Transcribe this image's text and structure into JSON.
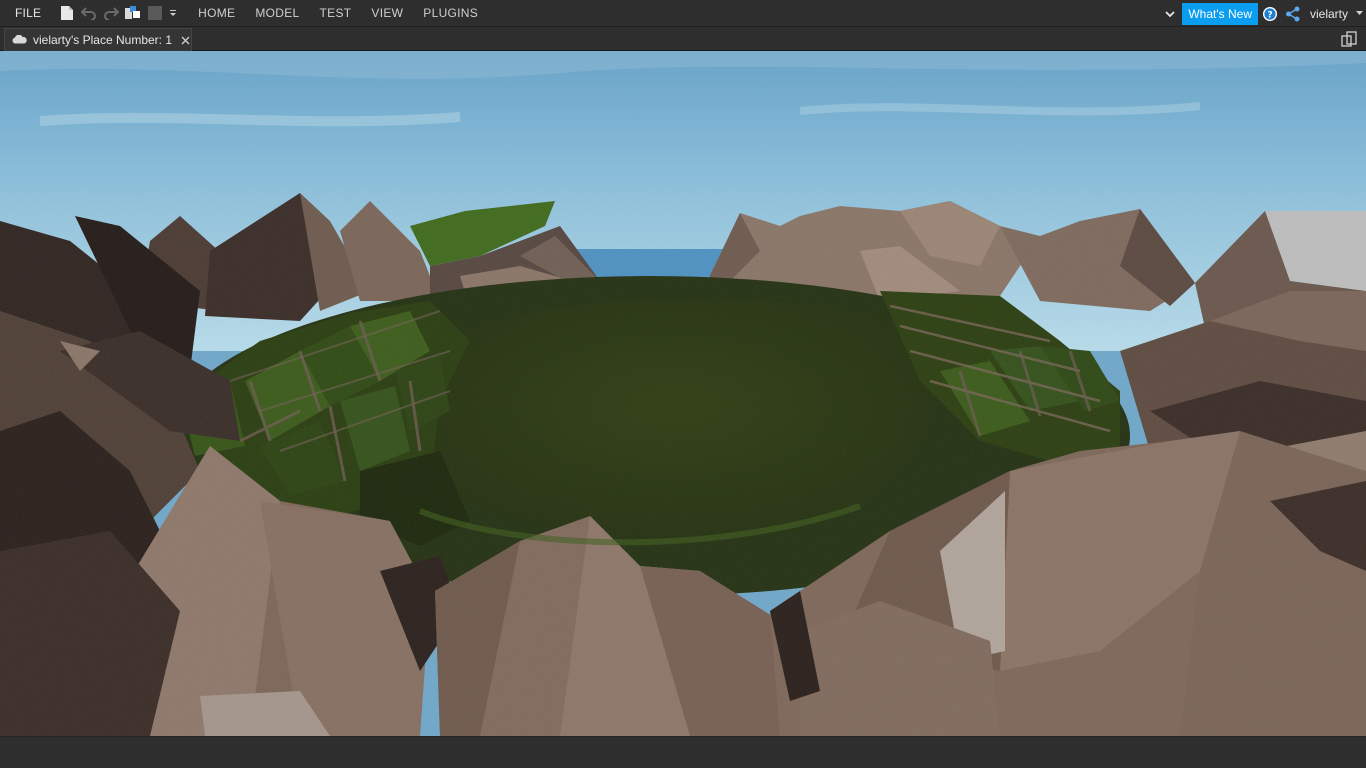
{
  "topbar": {
    "file_label": "FILE",
    "quick_access": [
      "new-file-icon",
      "undo-icon",
      "redo-icon",
      "group-icon",
      "square-icon",
      "customize-icon"
    ],
    "tabs": [
      {
        "label": "HOME"
      },
      {
        "label": "MODEL"
      },
      {
        "label": "TEST"
      },
      {
        "label": "VIEW"
      },
      {
        "label": "PLUGINS"
      }
    ],
    "whats_new_label": "What's New",
    "username": "vielarty",
    "accent_color": "#0a9df0"
  },
  "document_tab": {
    "label": "vielarty's Place Number: 1",
    "icon": "cloud-icon"
  },
  "viewport": {
    "scene": "terrain-crater-valley"
  }
}
